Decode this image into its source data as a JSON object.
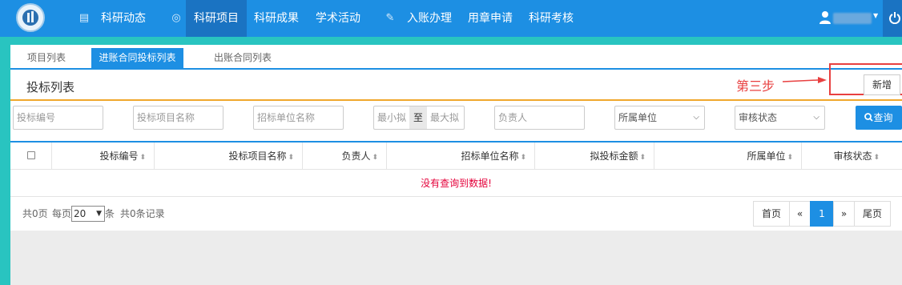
{
  "nav": {
    "items": [
      "科研动态",
      "科研项目",
      "科研成果",
      "学术活动",
      "入账办理",
      "用章申请",
      "科研考核"
    ],
    "active": "科研项目"
  },
  "tabs": [
    "项目列表",
    "进账合同投标列表",
    "出账合同列表"
  ],
  "active_tab": "进账合同投标列表",
  "section_title": "投标列表",
  "annotation": "第三步",
  "add_button": "新增",
  "filters": {
    "bid_no": "投标编号",
    "project_name": "投标项目名称",
    "unit_name": "招标单位名称",
    "min": "最小拟",
    "to": "至",
    "max": "最大拟",
    "owner": "负责人",
    "dept": "所属单位",
    "status": "审核状态"
  },
  "query_button": "查询",
  "table": {
    "headers": [
      "投标编号",
      "投标项目名称",
      "负责人",
      "招标单位名称",
      "拟投标金额",
      "所属单位",
      "审核状态"
    ],
    "empty_message": "没有查询到数据!"
  },
  "pagination": {
    "total_pages": "共0页",
    "per_page_label": "每页",
    "page_size": "20",
    "unit": "条",
    "total_records": "共0条记录",
    "first": "首页",
    "prev": "«",
    "current": "1",
    "next": "»",
    "last": "尾页"
  },
  "colors": {
    "primary": "#1d8fe3",
    "accent_line": "#f0a82c",
    "annotation": "#e84040",
    "empty": "#e4003a"
  }
}
